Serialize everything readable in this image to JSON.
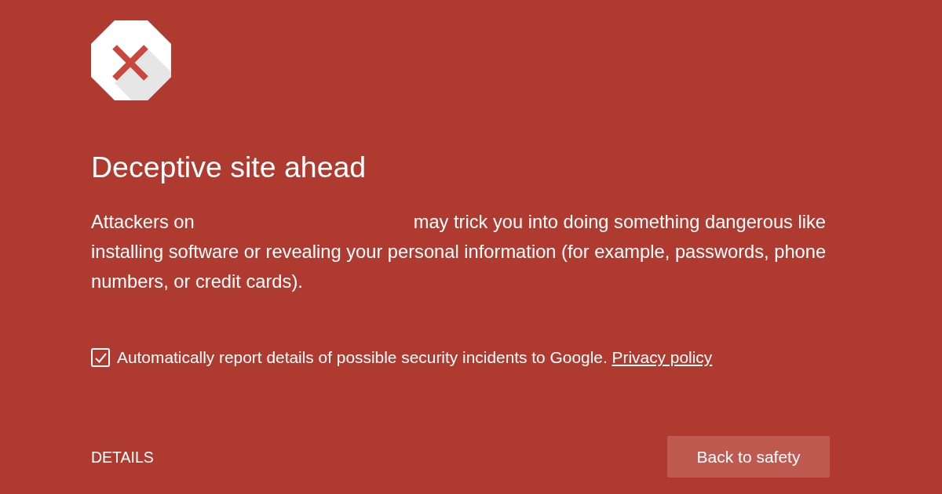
{
  "heading": "Deceptive site ahead",
  "message": {
    "before": "Attackers on",
    "after": "may trick you into doing something dangerous like installing software or revealing your personal information (for example, passwords, phone numbers, or credit cards)."
  },
  "report": {
    "checked": true,
    "label": "Automatically report details of possible security incidents to Google.",
    "link": "Privacy policy"
  },
  "details_link": "DETAILS",
  "button": "Back to safety"
}
